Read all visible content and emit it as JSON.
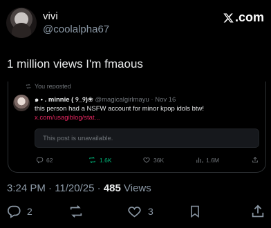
{
  "header": {
    "display_name": "vivi",
    "handle": "@coolalpha67",
    "brand": ".com",
    "brand_icon": "x-logo-icon"
  },
  "tweet": {
    "text": "1 million views I'm fmaous",
    "timestamp": "3:24 PM · 11/20/25 · ",
    "views_count": "485",
    "views_label": " Views"
  },
  "quote": {
    "reposted_label": "You reposted",
    "author_name": "๑ • . minnie ( ୨_୨)❀",
    "author_handle": "@magicalgirlmayu",
    "separator": " · ",
    "date": "Nov 16",
    "body": "this person had a NSFW account for minor kpop idols btw!",
    "link": "x.com/usagiblog/stat...",
    "unavailable": "This post is unavailable.",
    "stats": {
      "replies": "62",
      "reposts": "1.6K",
      "likes": "36K",
      "views": "1.6M"
    }
  },
  "actions": {
    "replies": "2",
    "likes": "3"
  },
  "colors": {
    "background": "#000000",
    "text": "#e7e9ea",
    "muted": "#71767b",
    "link": "#e0245e",
    "repost_green": "#00ba7c"
  }
}
